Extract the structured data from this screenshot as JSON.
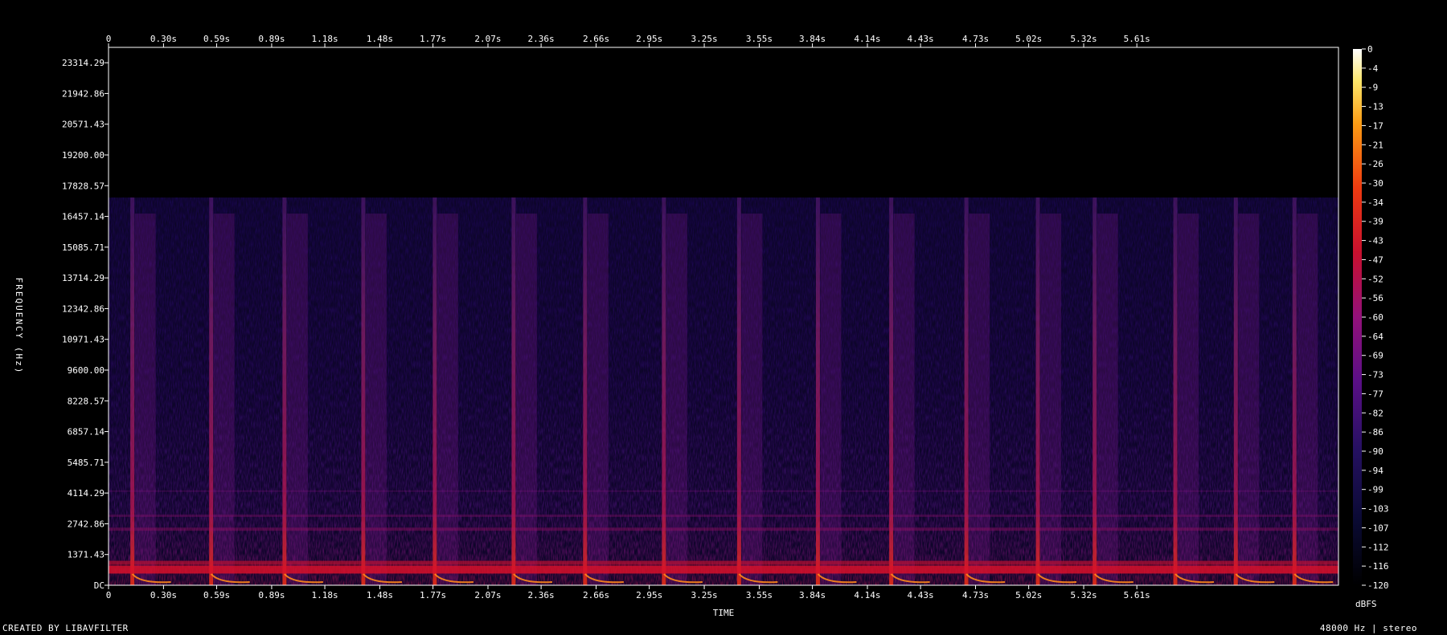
{
  "chart_data": {
    "type": "heatmap",
    "xlabel": "TIME",
    "ylabel": "FREQUENCY (Hz)",
    "x_ticks": [
      "0",
      "0.30s",
      "0.59s",
      "0.89s",
      "1.18s",
      "1.48s",
      "1.77s",
      "2.07s",
      "2.36s",
      "2.66s",
      "2.95s",
      "3.25s",
      "3.55s",
      "3.84s",
      "4.14s",
      "4.43s",
      "4.73s",
      "5.02s",
      "5.32s",
      "5.61s"
    ],
    "x_tick_values": [
      0,
      0.3,
      0.59,
      0.89,
      1.18,
      1.48,
      1.77,
      2.07,
      2.36,
      2.66,
      2.95,
      3.25,
      3.55,
      3.84,
      4.14,
      4.43,
      4.73,
      5.02,
      5.32,
      5.61
    ],
    "xlim": [
      0,
      6.71
    ],
    "y_ticks": [
      "DC",
      "1371.43",
      "2742.86",
      "4114.29",
      "5485.71",
      "6857.14",
      "8228.57",
      "9600.00",
      "10971.43",
      "12342.86",
      "13714.29",
      "15085.71",
      "16457.14",
      "17828.57",
      "19200.00",
      "20571.43",
      "21942.86",
      "23314.29"
    ],
    "y_tick_values": [
      0,
      1371.43,
      2742.86,
      4114.29,
      5485.71,
      6857.14,
      8228.57,
      9600.0,
      10971.43,
      12342.86,
      13714.29,
      15085.71,
      16457.14,
      17828.57,
      19200.0,
      20571.43,
      21942.86,
      23314.29
    ],
    "ylim": [
      0,
      24000
    ],
    "colorbar": {
      "label": "dBFS",
      "ticks": [
        "0",
        "-4",
        "-9",
        "-13",
        "-17",
        "-21",
        "-26",
        "-30",
        "-34",
        "-39",
        "-43",
        "-47",
        "-52",
        "-56",
        "-60",
        "-64",
        "-69",
        "-73",
        "-77",
        "-82",
        "-86",
        "-90",
        "-94",
        "-99",
        "-103",
        "-107",
        "-112",
        "-116",
        "-120"
      ],
      "range": [
        -120,
        0
      ]
    },
    "cutoff_hz": 17300,
    "onsets_s": [
      0.13,
      0.56,
      0.96,
      1.39,
      1.78,
      2.21,
      2.6,
      3.03,
      3.44,
      3.87,
      4.27,
      4.68,
      5.07,
      5.38,
      5.82,
      6.15,
      6.47
    ],
    "footer_left": "CREATED BY LIBAVFILTER",
    "footer_right": "48000 Hz | stereo"
  }
}
